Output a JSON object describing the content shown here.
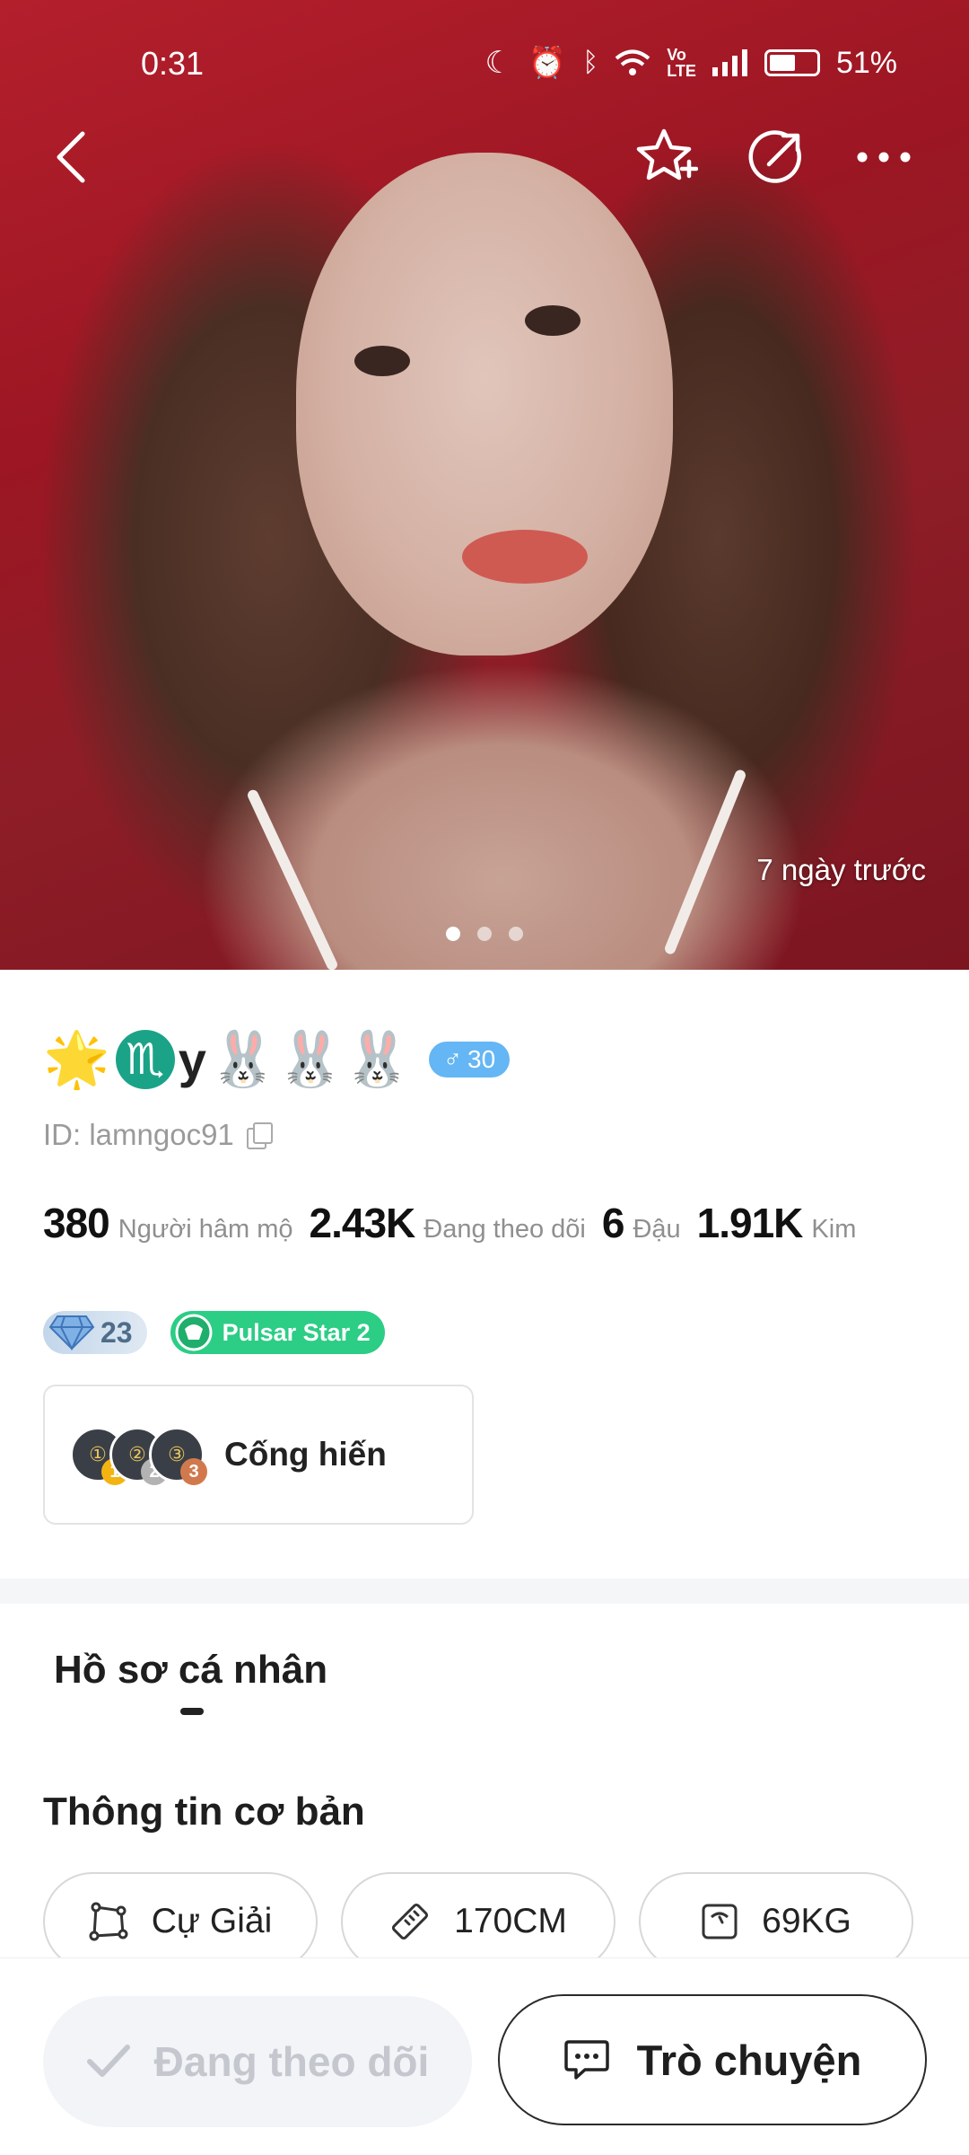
{
  "status_bar": {
    "time": "0:31",
    "battery": "51%",
    "icons": [
      "moon-icon",
      "alarm-icon",
      "bluetooth-icon",
      "wifi-icon",
      "volte-icon",
      "signal-icon",
      "battery-icon"
    ]
  },
  "header": {
    "buttons": [
      "back-icon",
      "star-plus-icon",
      "share-icon",
      "more-icon"
    ]
  },
  "photo": {
    "posted_time": "7 ngày trước",
    "page_count": 3,
    "active_page": 1
  },
  "profile": {
    "name_prefix_emoji": "🌟",
    "name_zodiac_emoji": "♏",
    "name_text": "y",
    "name_suffix_emoji": "🐰🐰🐰",
    "gender_symbol": "♂",
    "age": "30",
    "id_label": "ID: lamngoc91",
    "stats": [
      {
        "value": "380",
        "label": "Người hâm mộ"
      },
      {
        "value": "2.43K",
        "label": "Đang theo dõi"
      },
      {
        "value": "6",
        "label": "Đậu"
      },
      {
        "value": "1.91K",
        "label": "Kim"
      }
    ],
    "diamond_count": "23",
    "pulsar_label": "Pulsar Star 2",
    "contribution": {
      "label": "Cống hiến",
      "ranks": [
        "1",
        "2",
        "3"
      ]
    }
  },
  "tabs": {
    "personal": "Hồ sơ cá nhân"
  },
  "basic_info": {
    "title": "Thông tin cơ bản",
    "chips": [
      {
        "icon": "zodiac-frame-icon",
        "label": "Cự Giải"
      },
      {
        "icon": "ruler-icon",
        "label": "170CM"
      },
      {
        "icon": "scale-icon",
        "label": "69KG"
      }
    ]
  },
  "actions": {
    "follow_label": "Đang theo dõi",
    "chat_label": "Trò chuyện"
  },
  "colors": {
    "accent_green": "#2ccd85",
    "gender_blue": "#64b6f4",
    "follow_disabled_bg": "#f2f4f7"
  }
}
